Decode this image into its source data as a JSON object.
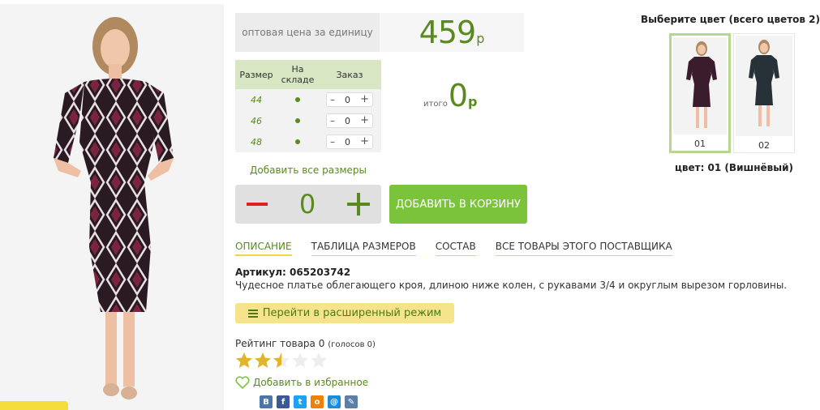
{
  "price": {
    "label": "оптовая цена за единицу",
    "value": "459",
    "currency": "р"
  },
  "sizes_table": {
    "headers": {
      "size": "Размер",
      "stock_line1": "На",
      "stock_line2": "складе",
      "order": "Заказ"
    },
    "rows": [
      {
        "size": "44",
        "qty": "0",
        "minus": "–",
        "plus": "+"
      },
      {
        "size": "46",
        "qty": "0",
        "minus": "–",
        "plus": "+"
      },
      {
        "size": "48",
        "qty": "0",
        "minus": "–",
        "plus": "+"
      }
    ]
  },
  "add_all_sizes": "Добавить все размеры",
  "total": {
    "label": "итого",
    "value": "0",
    "currency": "р"
  },
  "quantity": "0",
  "add_to_cart": "ДОБАВИТЬ В КОРЗИНУ",
  "tabs": [
    {
      "label": "ОПИСАНИЕ",
      "active": true
    },
    {
      "label": "ТАБЛИЦА РАЗМЕРОВ",
      "active": false
    },
    {
      "label": "СОСТАВ",
      "active": false
    },
    {
      "label": "ВСЕ ТОВАРЫ ЭТОГО ПОСТАВЩИКА",
      "active": false
    }
  ],
  "article": "Артикул: 065203742",
  "description": "Чудесное платье облегающего кроя, длиною ниже колен, с рукавами 3/4 и округлым вырезом горловины.",
  "advanced_mode": "Перейти в расширенный режим",
  "rating": {
    "label": "Рейтинг товара 0",
    "votes": "(голосов 0)",
    "stars_filled": 2.5,
    "stars_total": 5
  },
  "favorite": "Добавить в избранное",
  "social": [
    {
      "icon": "vk-icon",
      "glyph": "B",
      "color": "#4a76a8"
    },
    {
      "icon": "facebook-icon",
      "glyph": "f",
      "color": "#3b5998"
    },
    {
      "icon": "twitter-icon",
      "glyph": "t",
      "color": "#1da1f2"
    },
    {
      "icon": "odnoklassniki-icon",
      "glyph": "o",
      "color": "#ee8208"
    },
    {
      "icon": "mail-icon",
      "glyph": "@",
      "color": "#168de2"
    },
    {
      "icon": "livejournal-icon",
      "glyph": "✎",
      "color": "#5b7fa6"
    }
  ],
  "colors": {
    "title": "Выберите цвет (всего цветов 2)",
    "swatches": [
      {
        "num": "01",
        "selected": true
      },
      {
        "num": "02",
        "selected": false
      }
    ],
    "current": "цвет: 01 (Вишнёвый)"
  },
  "theme": {
    "accent_green": "#5a8a1e",
    "button_green": "#7cc33c",
    "minus_red": "#e02020",
    "tab_underline": "#f0d44a"
  }
}
